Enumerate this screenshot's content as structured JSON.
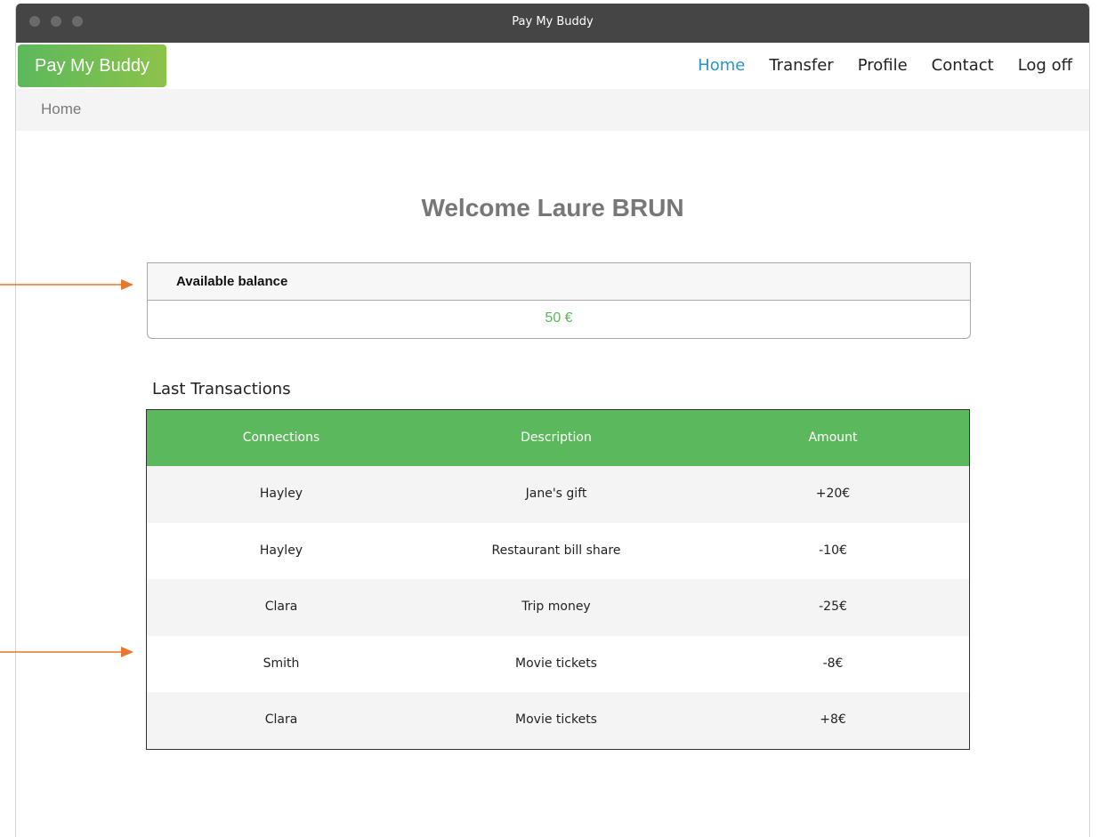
{
  "window": {
    "title": "Pay My Buddy"
  },
  "brand": "Pay My Buddy",
  "nav": {
    "home": "Home",
    "transfer": "Transfer",
    "profile": "Profile",
    "contact": "Contact",
    "logoff": "Log off",
    "active": "Home"
  },
  "breadcrumb": "Home",
  "welcome": "Welcome Laure BRUN",
  "balance": {
    "label": "Available balance",
    "value": "50 €"
  },
  "transactions": {
    "title": "Last Transactions",
    "headers": [
      "Connections",
      "Description",
      "Amount"
    ],
    "rows": [
      [
        "Hayley",
        "Jane's gift",
        "+20€"
      ],
      [
        "Hayley",
        "Restaurant bill share",
        "-10€"
      ],
      [
        "Clara",
        "Trip money",
        "-25€"
      ],
      [
        "Smith",
        "Movie tickets",
        "-8€"
      ],
      [
        "Clara",
        "Movie tickets",
        "+8€"
      ]
    ]
  },
  "colors": {
    "brand_green": "#5cb85c",
    "nav_active": "#2b93d1",
    "annotation_arrow": "#e8762c",
    "titlebar": "#454545"
  }
}
